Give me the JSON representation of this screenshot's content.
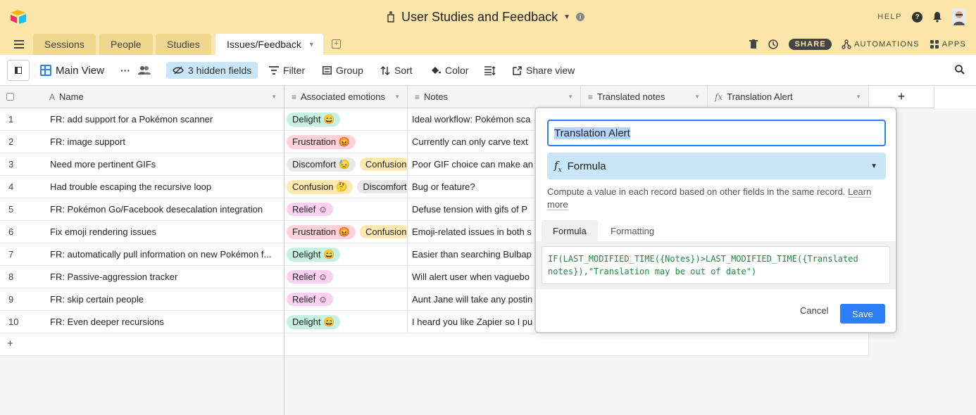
{
  "app": {
    "title": "User Studies and Feedback",
    "help_label": "HELP"
  },
  "tabs": [
    {
      "label": "Sessions"
    },
    {
      "label": "People"
    },
    {
      "label": "Studies"
    },
    {
      "label": "Issues/Feedback"
    }
  ],
  "tab_right": {
    "share_label": "SHARE",
    "automations_label": "AUTOMATIONS",
    "apps_label": "APPS"
  },
  "toolbar": {
    "view_name": "Main View",
    "hidden_fields_label": "3 hidden fields",
    "filter_label": "Filter",
    "group_label": "Group",
    "sort_label": "Sort",
    "color_label": "Color",
    "share_view_label": "Share view"
  },
  "columns": [
    {
      "label": "Name",
      "icon": "A"
    },
    {
      "label": "Associated emotions",
      "icon": "≡"
    },
    {
      "label": "Notes",
      "icon": "≡"
    },
    {
      "label": "Translated notes",
      "icon": "≡"
    },
    {
      "label": "Translation Alert",
      "icon": "fx"
    }
  ],
  "add_column_label": "+",
  "rows": [
    {
      "num": "1",
      "name": "FR: add support for a Pokémon scanner",
      "emotions": [
        {
          "label": "Delight 😄",
          "kind": "delight"
        }
      ],
      "notes": "Ideal workflow: Pokémon sca"
    },
    {
      "num": "2",
      "name": "FR: image support",
      "emotions": [
        {
          "label": "Frustration 😡",
          "kind": "frustration"
        }
      ],
      "notes": "Currently can only carve text"
    },
    {
      "num": "3",
      "name": "Need more pertinent GIFs",
      "emotions": [
        {
          "label": "Discomfort 😓",
          "kind": "discomfort"
        },
        {
          "label": "Confusion",
          "kind": "confusion"
        }
      ],
      "notes": "Poor GIF choice can make an"
    },
    {
      "num": "4",
      "name": "Had trouble escaping the recursive loop",
      "emotions": [
        {
          "label": "Confusion 🤔",
          "kind": "confusion"
        },
        {
          "label": "Discomfort",
          "kind": "discomfort"
        }
      ],
      "notes": "Bug or feature?"
    },
    {
      "num": "5",
      "name": "FR: Pokémon Go/Facebook desecalation integration",
      "emotions": [
        {
          "label": "Relief ☺",
          "kind": "relief"
        }
      ],
      "notes": "Defuse tension with gifs of P"
    },
    {
      "num": "6",
      "name": "Fix emoji rendering issues",
      "emotions": [
        {
          "label": "Frustration 😡",
          "kind": "frustration"
        },
        {
          "label": "Confusion",
          "kind": "confusion"
        }
      ],
      "notes": "Emoji-related issues in both s"
    },
    {
      "num": "7",
      "name": "FR: automatically pull information on new Pokémon f...",
      "emotions": [
        {
          "label": "Delight 😄",
          "kind": "delight"
        }
      ],
      "notes": "Easier than searching Bulbap"
    },
    {
      "num": "8",
      "name": "FR: Passive-aggression tracker",
      "emotions": [
        {
          "label": "Relief ☺",
          "kind": "relief"
        }
      ],
      "notes": "Will alert user when vaguebo"
    },
    {
      "num": "9",
      "name": "FR: skip certain people",
      "emotions": [
        {
          "label": "Relief ☺",
          "kind": "relief"
        }
      ],
      "notes": "Aunt Jane will take any postin"
    },
    {
      "num": "10",
      "name": "FR: Even deeper recursions",
      "emotions": [
        {
          "label": "Delight 😄",
          "kind": "delight"
        }
      ],
      "notes": "I heard you like Zapier so I pu"
    }
  ],
  "add_row_label": "+",
  "field_editor": {
    "field_name": "Translation Alert",
    "field_type": "Formula",
    "description": "Compute a value in each record based on other fields in the same record.",
    "learn_more": "Learn more",
    "tab_formula": "Formula",
    "tab_formatting": "Formatting",
    "formula": "IF(LAST_MODIFIED_TIME({Notes})>LAST_MODIFIED_TIME({Translated notes}),\"Translation may be out of date\")",
    "cancel_label": "Cancel",
    "save_label": "Save"
  },
  "colors": {
    "header_bg": "#fce5a8",
    "accent_blue": "#2d7ff9",
    "hidden_fields_bg": "#c9e5f8"
  }
}
